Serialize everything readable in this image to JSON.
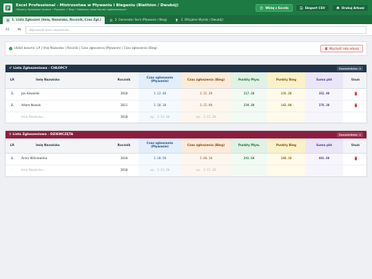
{
  "header": {
    "title": "Excel Professional - Mistrzostwa w Pływaniu i Bieganiu (Biathlon / Dwubój)",
    "subtitle": "Oficjalny Sędziowski System • Pływanie + Bieg • Dokładny układ kolumn zgłoszeniowych",
    "buttons": {
      "paste": "Wklej z Excela",
      "csv": "Eksport CSV",
      "print": "Drukuj Arkusz"
    }
  },
  "tabs": [
    {
      "label": "1. Lista Zgłoszeń (Imię, Nazwisko, Rocznik, Czas Zgł.)"
    },
    {
      "label": "2. Generator Serii (Pływanie / Bieg)"
    },
    {
      "label": "3. Oficjalne Wyniki i Dwubój)"
    }
  ],
  "formula_bar": {
    "cell": "A1",
    "fx": "fx",
    "placeholder": "Wprowadź dane zawodnika..."
  },
  "info": {
    "text": "Układ kolumn: LP | Imię Nazwisko | Rocznik | Czas zgłoszenia (Pływanie) | Czas zgłoszenia (Bieg)",
    "clear_button": "Wyczyść cały arkusz"
  },
  "columns": {
    "lp": "LP.",
    "name": "Imię Nazwisko",
    "year": "Rocznik",
    "swim": "Czas zgłoszenia (Pływanie)",
    "run": "Czas zgłoszenia (Bieg)",
    "pswim": "Punkty Pływ.",
    "prun": "Punkty Bieg",
    "sum": "Suma pkt",
    "del": "Usuń"
  },
  "male": {
    "title": "Lista Zgłoszeniowa - CHŁOPCY",
    "count": "Zawodników: 2",
    "rows": [
      {
        "lp": "1.",
        "name": "Jan Kowalski",
        "year": "2010",
        "swim": "1:12.40",
        "run": "2:15.20",
        "pswim": "217.20",
        "prun": "135.20",
        "sum": "352.40"
      },
      {
        "lp": "2.",
        "name": "Adam Nowak",
        "year": "2011",
        "swim": "1:18.10",
        "run": "2:22.90",
        "pswim": "234.30",
        "prun": "142.00",
        "sum": "376.30"
      }
    ],
    "new_row": {
      "lp": "-",
      "name": "Imię Nazwisko...",
      "year": "2010",
      "swim": "np. 1:12.40",
      "run": "np. 2:15.20"
    }
  },
  "female": {
    "title": "Lista Zgłoszeniowa - DZIEWCZĘTA",
    "count": "Zawodników: 1",
    "rows": [
      {
        "lp": "1.",
        "name": "Anna Wiśniewska",
        "year": "2010",
        "swim": "1:20.50",
        "run": "2:40.10",
        "pswim": "241.50",
        "prun": "160.10",
        "sum": "401.60"
      }
    ],
    "new_row": {
      "lp": "-",
      "name": "Imię Nazwisko...",
      "year": "2010",
      "swim": "np. 1:12.40",
      "run": "np. 2:15.20"
    }
  }
}
